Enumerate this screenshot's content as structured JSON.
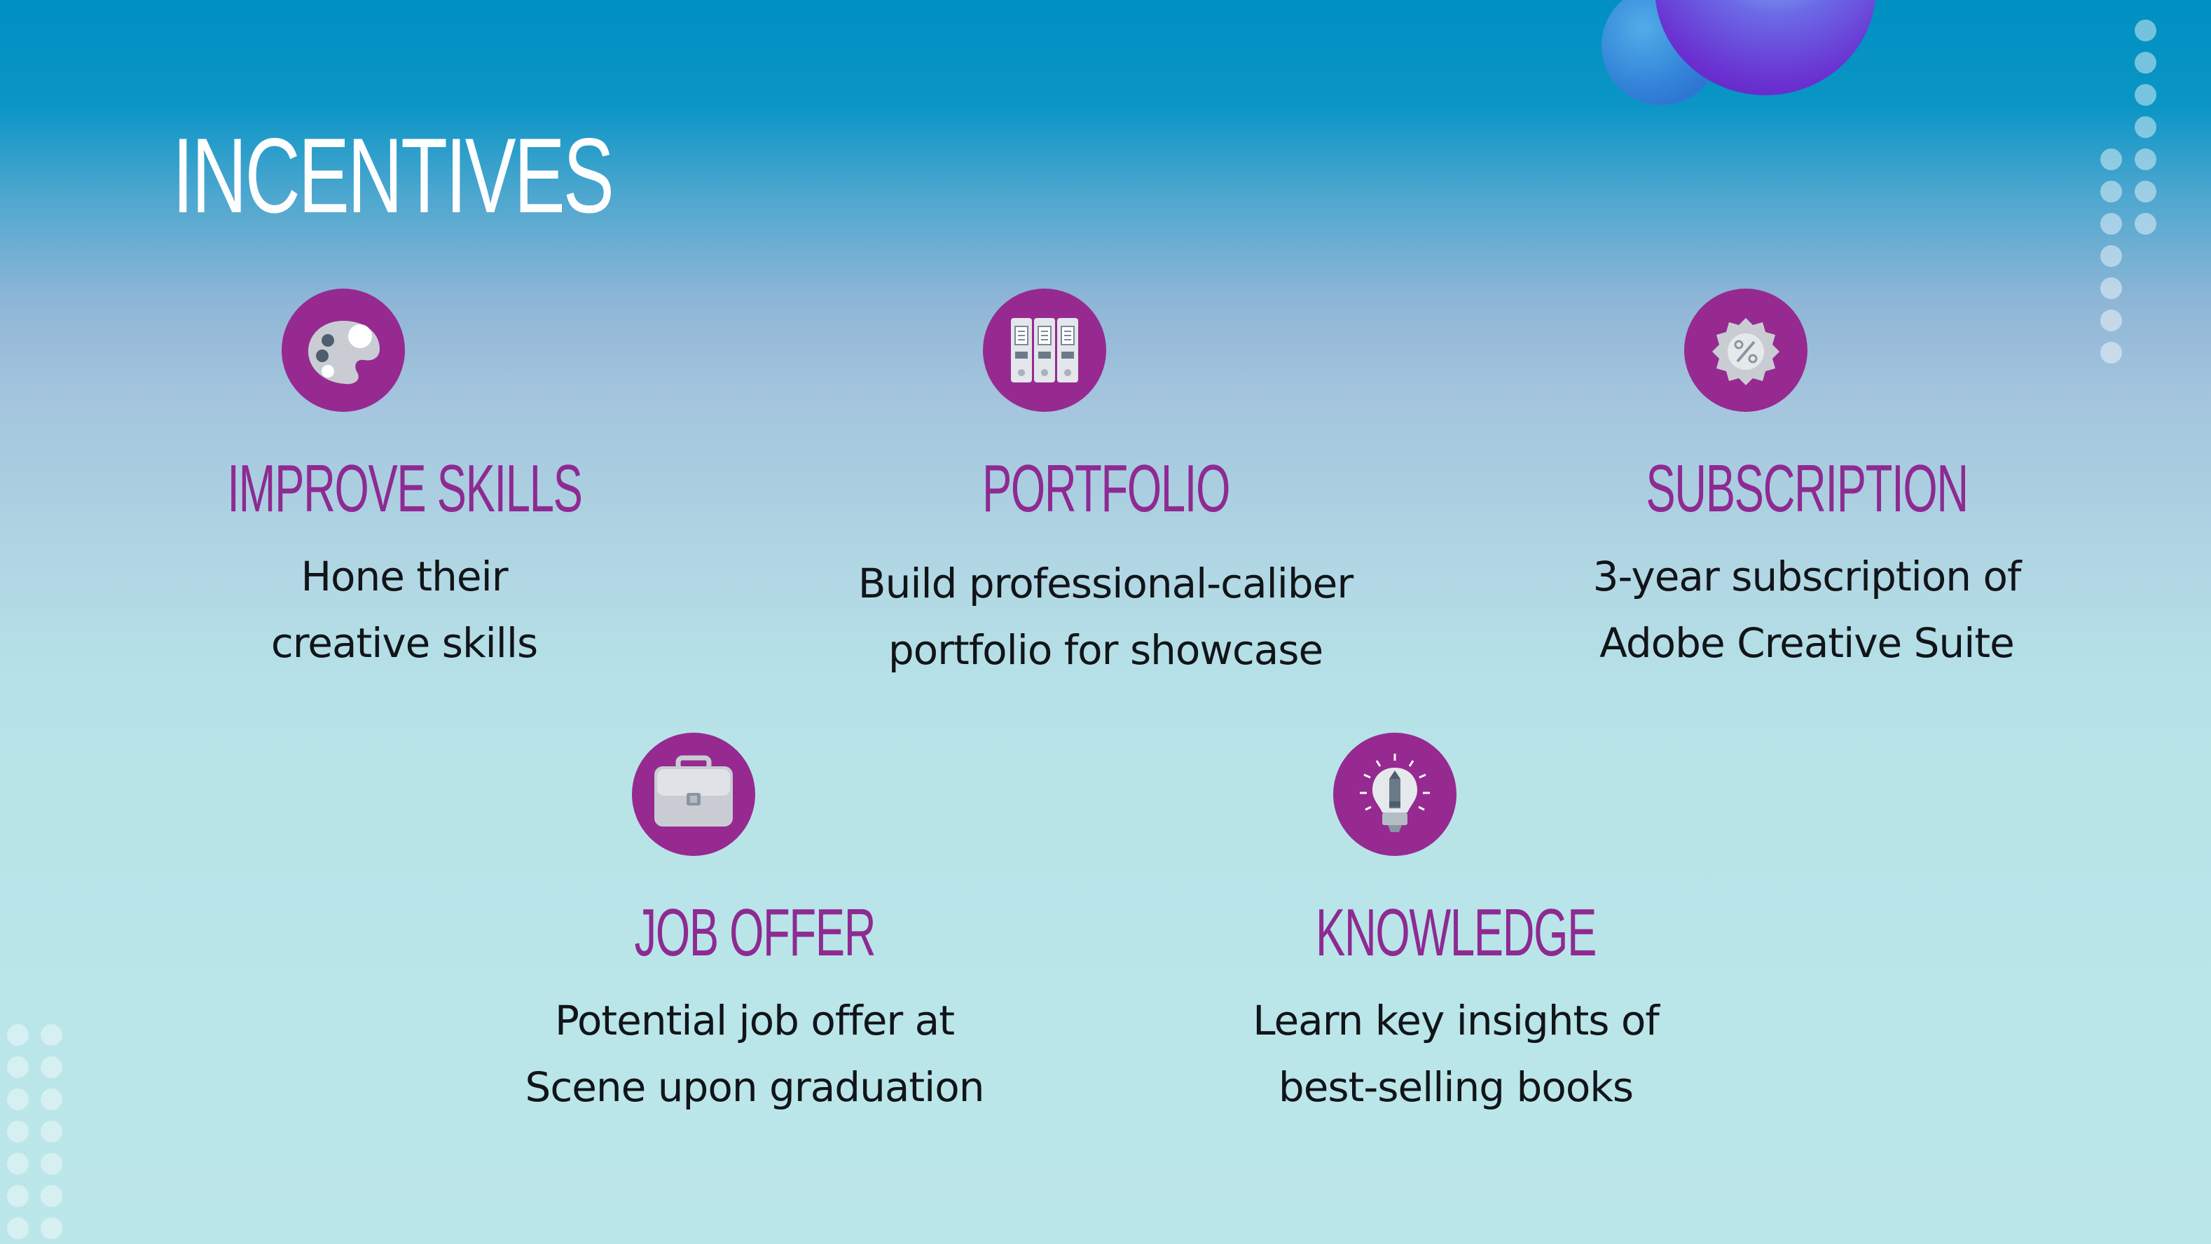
{
  "slide": {
    "title": "INCENTIVES",
    "colors": {
      "accent": "#962a90",
      "heading": "#8e2a92",
      "title": "#ffffff",
      "body_text": "#111418",
      "background_top": "#0090c2",
      "background_bottom": "#bce7ea"
    }
  },
  "incentives": [
    {
      "icon": "paint-palette-icon",
      "heading": "IMPROVE SKILLS",
      "description": "Hone their creative skills"
    },
    {
      "icon": "binders-icon",
      "heading": "PORTFOLIO",
      "description": "Build professional-caliber portfolio for showcase"
    },
    {
      "icon": "discount-badge-icon",
      "heading": "SUBSCRIPTION",
      "description": "3-year subscription of Adobe Creative Suite"
    },
    {
      "icon": "briefcase-icon",
      "heading": "JOB OFFER",
      "description": "Potential job offer at Scene upon graduation"
    },
    {
      "icon": "lightbulb-pencil-icon",
      "heading": "KNOWLEDGE",
      "description": "Learn key insights of best-selling books"
    }
  ]
}
